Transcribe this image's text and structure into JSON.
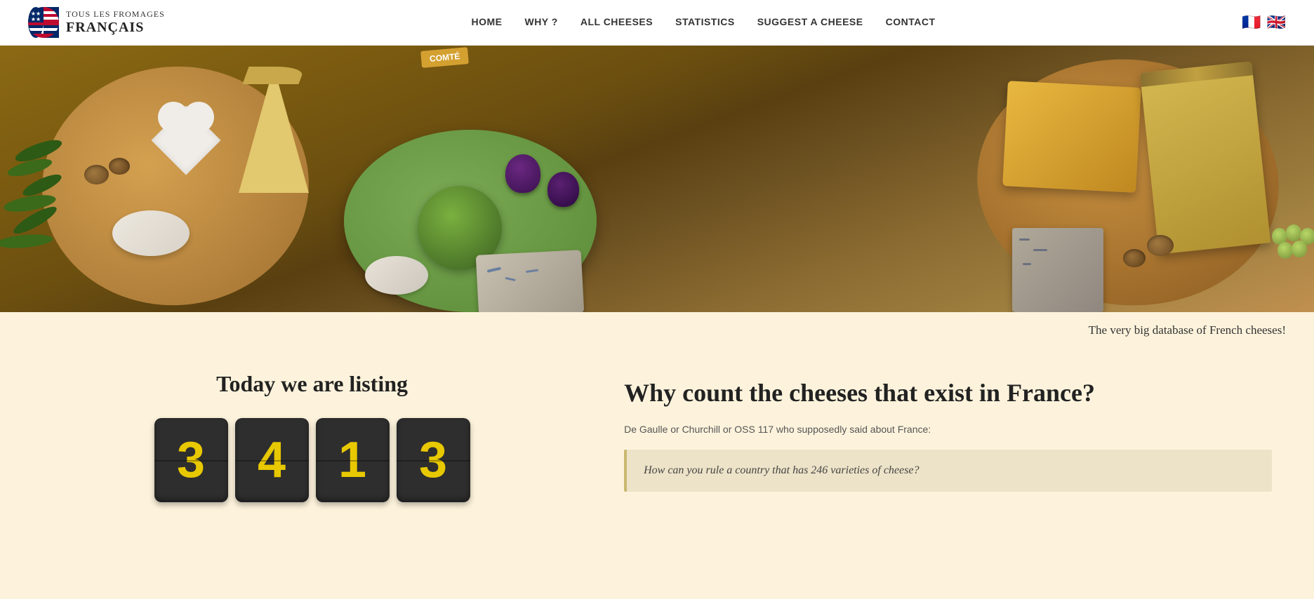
{
  "site": {
    "title_top": "TOUS LES FROMAGES",
    "title_bottom": "FRANÇAIS"
  },
  "nav": {
    "home": "HOME",
    "why": "WHY ?",
    "all_cheeses": "ALL CHEESES",
    "statistics": "STATISTICS",
    "suggest": "SUGGEST A CHEESE",
    "contact": "CONTACT"
  },
  "subtitle": "The very big database of French cheeses!",
  "listing": {
    "title": "Today we are listing",
    "digits": [
      "3",
      "4",
      "1",
      "3"
    ]
  },
  "why": {
    "title": "Why count the cheeses that exist in France?",
    "intro": "De Gaulle or Churchill or OSS 117 who supposedly said about France:",
    "quote": "How can you rule a country that has 246 varieties of cheese?"
  },
  "hero": {
    "comte_label": "COMTÉ"
  }
}
